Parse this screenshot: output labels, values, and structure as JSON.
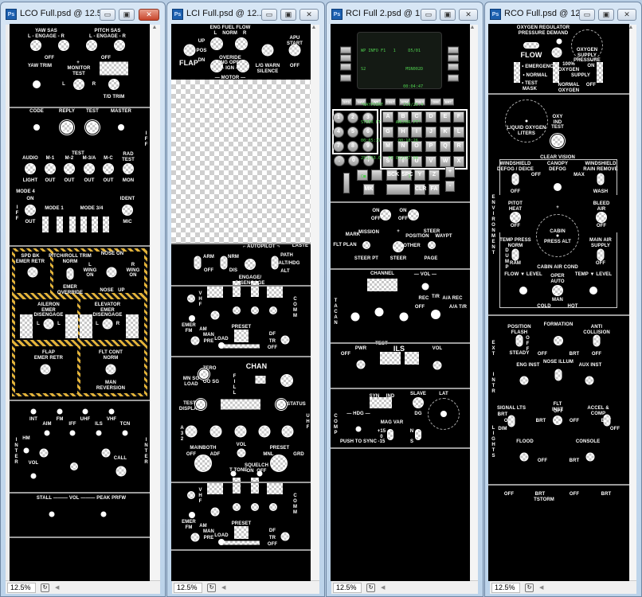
{
  "windows": [
    {
      "id": "lco",
      "title": "LCO Full.psd @ 12.5...",
      "zoom": "12.5%",
      "active": true
    },
    {
      "id": "lci",
      "title": "LCI Full.psd @ 12...",
      "zoom": "12.5%",
      "active": false
    },
    {
      "id": "rci",
      "title": "RCI Full 2.psd @ 1...",
      "zoom": "12.5%",
      "active": false
    },
    {
      "id": "rco",
      "title": "RCO Full.psd @ 12...",
      "zoom": "12.5%",
      "active": false
    }
  ],
  "icons": {
    "app": "photoshop-icon",
    "min": "minimize-icon",
    "max": "maximize-icon",
    "close": "close-icon"
  },
  "ps_badge": "Ps",
  "glyphs": {
    "min": "▭",
    "max": "▣",
    "close": "✕",
    "up": "▲",
    "down": "▼",
    "left": "◀",
    "right": "▶"
  },
  "colors": {
    "hazard": "#e4b43a",
    "cdu_text": "#4fcf4f",
    "panel": "#000000"
  },
  "lco": {
    "yaw_sas": "YAW SAS",
    "pitch_sas": "PITCH SAS",
    "engage": "L - ENGAGE - R",
    "off": "OFF",
    "yaw_trim": "YAW TRIM",
    "l": "L",
    "r": "R",
    "plus": "+",
    "monitor_test": "MONITOR\nTEST",
    "td_trim": "T/D TRIM",
    "code": "CODE",
    "reply": "REPLY",
    "test": "TEST",
    "master": "MASTER",
    "iff": "IFF",
    "audio": "AUDIO",
    "light": "LIGHT",
    "m1": "M-1",
    "m2": "M-2",
    "m3a": "M-3/A",
    "mc": "M-C",
    "out": "OUT",
    "on": "ON",
    "rad_test": "RAD\nTEST",
    "mon": "MON",
    "mode4": "MODE 4",
    "ident": "IDENT",
    "mic": "MIC",
    "mode1": "MODE 1",
    "mode34": "MODE 3/4",
    "spd_bk": "SPD BK\nEMER RETR",
    "pitch_roll": "PITCH/ROLL TRIM\nNORM",
    "emer_override": "EMER\nOVERRIDE",
    "nose_on": "NOSE ON",
    "l_wing": "L\nWING\nON",
    "r_wing": "R\nWING\nON",
    "nose_up": "NOSE   UP",
    "aileron": "AILERON\nEMER\nDISENGAGE",
    "elevator": "ELEVATOR\nEMER\nDISENGAGE",
    "flap": "FLAP\nEMER RETR",
    "flt_cont": "FLT CONT\nNORM",
    "man_rev": "MAN\nREVERSION",
    "int": "INT",
    "fm": "FM",
    "uhf": "UHF",
    "vhf": "VHF",
    "aim": "AIM",
    "ils": "ILS",
    "tcn": "TCN",
    "inter": "INTER",
    "hm": "HM",
    "vol": "VOL",
    "call": "CALL",
    "stall_vol": "STALL ——— VOL ——— PEAK PRFW"
  },
  "lci": {
    "eng_fuel_flow": "ENG FUEL FLOW\nL    NORM    R",
    "overide": "OVERIDE",
    "eng_oper": "ENG OPER\nL — IGN — R",
    "motor": "— MOTOR —",
    "flap": "FLAP",
    "up": "UP",
    "pos": "POS",
    "dn": "DN",
    "lg_warn": "L/G WARN\nSILENCE",
    "apu_start": "APU\nSTART",
    "off": "OFF",
    "autopilot": "⌐ AUTOPILOT ¬",
    "laste": "LASTE",
    "arm": "ARM",
    "nrm": "NRM",
    "dis": "DIS",
    "engage": "ENGAGE/\nDISENGAGE",
    "path": "PATH",
    "alt_hdg": "ALT/HDG",
    "alt": "ALT",
    "vhf": "VHF",
    "comm": "COMM",
    "emer_fm": "EMER\nFM",
    "am": "AM",
    "man": "MAN",
    "pre": "PRE",
    "load": "LOAD",
    "preset": "PRESET",
    "df": "DF",
    "tr": "TR",
    "chan": "CHAN",
    "zero": "ZERO",
    "mn_sg": "MN SG\nLOAD",
    "oo_sg": "OO SG",
    "fill": "FILL",
    "test_display": "TEST\nDISPLAY",
    "status": "STATUS",
    "uhf": "UHF",
    "a32": "A32",
    "mainboth": "MAINBOTH",
    "adf": "ADF",
    "vol": "VOL",
    "mnl": "MNL",
    "grd": "GRD",
    "t": "T",
    "tone": "TONE",
    "squelch": "SQUELCH\nON  OFF"
  },
  "rci": {
    "cdu_lines": [
      "WP INFO F1   1     D5/01",
      "S2                MSN002D",
      "                 00:04:47",
      "*WAYPOINT        219/26.4",
      "STEER PT      ANCHOR PT*",
      "00:05:37       00:10:26",
      "251/53.0   FR 072/57.58",
      "C■                 1"
    ],
    "fn_keys": [
      "SYS",
      "NAV",
      "WP",
      "OSET",
      "FPM",
      "PREV",
      "DIM",
      "BRT"
    ],
    "num_keys": [
      "1",
      "2",
      "3",
      "4",
      "5",
      "6",
      "7",
      "8",
      "9",
      ".",
      "0",
      "/"
    ],
    "letter_keys": [
      "A",
      "B",
      "C",
      "D",
      "E",
      "F",
      "G",
      "H",
      "I",
      "J",
      "K",
      "L",
      "M",
      "N",
      "O",
      "P",
      "Q",
      "R",
      "S",
      "T",
      "U",
      "V",
      "W",
      "X"
    ],
    "bottom_keys": [
      "",
      "",
      "BCK",
      "SPC",
      "Y",
      "Z",
      "+",
      "-",
      "MK",
      "",
      "CLR",
      "FA"
    ],
    "on": "ON",
    "off": "OFF",
    "plus": "+",
    "mark": "MARK",
    "mission": "MISSION",
    "flt_plan": "FLT PLAN",
    "steer_pt": "STEER PT",
    "steer": "STEER",
    "position": "POSITION",
    "waypt": "WAYPT",
    "other": "OTHER",
    "page": "PAGE",
    "tacan": "TACAN",
    "channel": "CHANNEL",
    "test": "TEST",
    "vol": "— VOL —",
    "rec": "REC",
    "tr": "T/R",
    "aa_rec": "A/A REC",
    "aa_tr": "A/A T/R",
    "pwr": "PWR",
    "ils": "ILS",
    "vol2": "VOL",
    "comp": "COMP",
    "syn": "SYN",
    "ind": "IND",
    "slave": "SLAVE",
    "dg": "DG",
    "lat": "LAT",
    "hdg": "— HDG —",
    "push_sync": "PUSH TO SYNC",
    "mag_var": "MAG VAR",
    "var_vals": "+15\n0\n-15",
    "ns": "N\n\nS"
  },
  "rco": {
    "oxy_reg": "OXYGEN REGULATOR",
    "pressure_demand": "PRESSURE DEMAND",
    "flow": "FLOW",
    "emergency": "• EMERGENCY",
    "normal": "• NORMAL",
    "test_mask": "• TEST\nMASK",
    "oxy100": "100%\nOXYGEN",
    "normal_oxy": "NORMAL\nOXYGEN",
    "supply": "SUPPLY",
    "on": "ON",
    "off": "OFF",
    "oxy_supply_gauge": "OXYGEN\nSUPPLY\nPRESSURE",
    "liquid_oxy": "LIQUID OXYGEN\nLITERS",
    "oxy_ind_test": "OXY\nIND\nTEST",
    "clear_vision": "CLEAR VISION",
    "ws_defog": "WINDSHIELD\nDEFOG / DEICE",
    "canopy_defog": "CANOPY\nDEFOG",
    "max": "MAX",
    "ws_rain": "WINDSHIELD\nRAIN REMOVE",
    "wash": "WASH",
    "environment": "ENVIRONMENT",
    "pitot_heat": "PITOT\nHEAT",
    "bleed_air": "BLEED\nAIR",
    "plus": "+",
    "cabin_gauge": "CABIN\n\nPRESS ALT",
    "temp_press": "TEMP PRESS\nNORM",
    "dump": "DUMP",
    "ram": "RAM",
    "main_air": "MAIN AIR\nSUPPLY",
    "cabin_air": "CABIN AIR COND",
    "flow_level": "FLOW ▼ LEVEL",
    "temp_level": "TEMP ▼ LEVEL",
    "oper_auto": "OPER\nAUTO",
    "man": "MAN",
    "cold": "COLD",
    "hot": "HOT",
    "position_flash": "POSITION\nFLASH",
    "steady": "STEADY",
    "formation": "FORMATION",
    "brt": "BRT",
    "anti_collision": "ANTI\nCOLLISION",
    "ext": "EXT",
    "nose_illum": "NOSE ILLUM",
    "eng_inst": "ENG INST",
    "aux_inst": "AUX INST",
    "flt_inst": "FLT\nINST",
    "signal_lts": "SIGNAL LTS",
    "dim": "DIM",
    "accel_comp": "ACCEL &\nCOMP",
    "intr": "INTR",
    "lights": "LIGHTS",
    "flood": "FLOOD",
    "tstorm": "TSTORM",
    "console": "CONSOLE"
  }
}
